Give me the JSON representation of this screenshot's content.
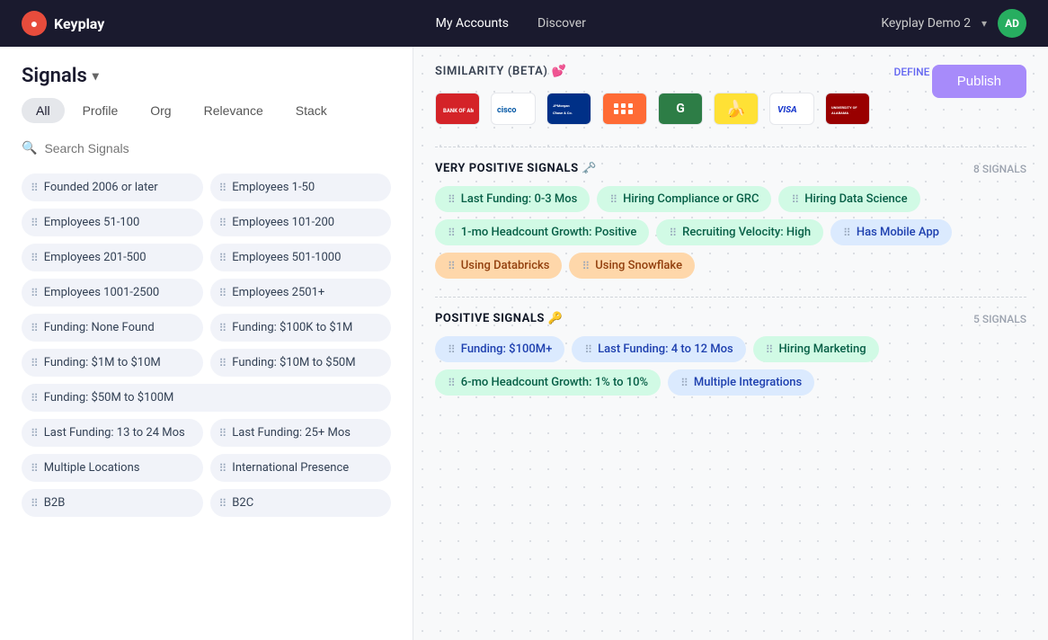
{
  "navbar": {
    "brand": "Keyplay",
    "nav_items": [
      {
        "label": "My Accounts",
        "active": true
      },
      {
        "label": "Discover",
        "active": false
      }
    ],
    "workspace": "Keyplay Demo 2",
    "avatar_initials": "AD"
  },
  "page": {
    "title": "Signals",
    "publish_label": "Publish"
  },
  "filter_tabs": [
    {
      "label": "All",
      "active": true
    },
    {
      "label": "Profile",
      "active": false
    },
    {
      "label": "Org",
      "active": false
    },
    {
      "label": "Relevance",
      "active": false
    },
    {
      "label": "Stack",
      "active": false
    }
  ],
  "search": {
    "placeholder": "Search Signals"
  },
  "left_signals": [
    {
      "label": "Founded 2006 or later"
    },
    {
      "label": "Employees 1-50"
    },
    {
      "label": "Employees 51-100"
    },
    {
      "label": "Employees 101-200"
    },
    {
      "label": "Employees 201-500"
    },
    {
      "label": "Employees 501-1000"
    },
    {
      "label": "Employees 1001-2500"
    },
    {
      "label": "Employees 2501+"
    },
    {
      "label": "Funding: None Found"
    },
    {
      "label": "Funding: $100K to $1M"
    },
    {
      "label": "Funding: $1M to $10M"
    },
    {
      "label": "Funding: $10M to $50M"
    },
    {
      "label": "Funding: $50M to $100M",
      "full": true
    },
    {
      "label": "Last Funding: 13 to 24 Mos"
    },
    {
      "label": "Last Funding: 25+ Mos"
    },
    {
      "label": "Multiple Locations"
    },
    {
      "label": "International Presence"
    },
    {
      "label": "B2B"
    },
    {
      "label": "B2C"
    }
  ],
  "similarity_section": {
    "title": "SIMILARITY (BETA) 💕",
    "define_link": "DEFINE LOOKALIKE LIST →",
    "logos": [
      {
        "label": "BofA",
        "style": "bofa"
      },
      {
        "label": "CISCO",
        "style": "cisco"
      },
      {
        "label": "JPM",
        "style": "jpm"
      },
      {
        "label": "⊞",
        "style": "zing"
      },
      {
        "label": "G",
        "style": "g"
      },
      {
        "label": "🍌",
        "style": "banana"
      },
      {
        "label": "VISA",
        "style": "visa"
      },
      {
        "label": "ALA",
        "style": "ala"
      }
    ]
  },
  "very_positive_signals": {
    "title": "VERY POSITIVE SIGNALS 🗝️",
    "count": "8 SIGNALS",
    "tags": [
      {
        "label": "Last Funding: 0-3 Mos",
        "style": "green"
      },
      {
        "label": "Hiring Compliance or GRC",
        "style": "green"
      },
      {
        "label": "Hiring Data Science",
        "style": "green"
      },
      {
        "label": "1-mo Headcount Growth: Positive",
        "style": "green"
      },
      {
        "label": "Recruiting Velocity: High",
        "style": "green"
      },
      {
        "label": "Has Mobile App",
        "style": "blue"
      },
      {
        "label": "Using Databricks",
        "style": "orange"
      },
      {
        "label": "Using Snowflake",
        "style": "orange"
      }
    ]
  },
  "positive_signals": {
    "title": "POSITIVE SIGNALS 🔑",
    "count": "5 SIGNALS",
    "tags": [
      {
        "label": "Funding: $100M+",
        "style": "blue"
      },
      {
        "label": "Last Funding: 4 to 12 Mos",
        "style": "blue"
      },
      {
        "label": "Hiring Marketing",
        "style": "green"
      },
      {
        "label": "6-mo Headcount Growth: 1% to 10%",
        "style": "green"
      },
      {
        "label": "Multiple Integrations",
        "style": "blue"
      }
    ]
  }
}
